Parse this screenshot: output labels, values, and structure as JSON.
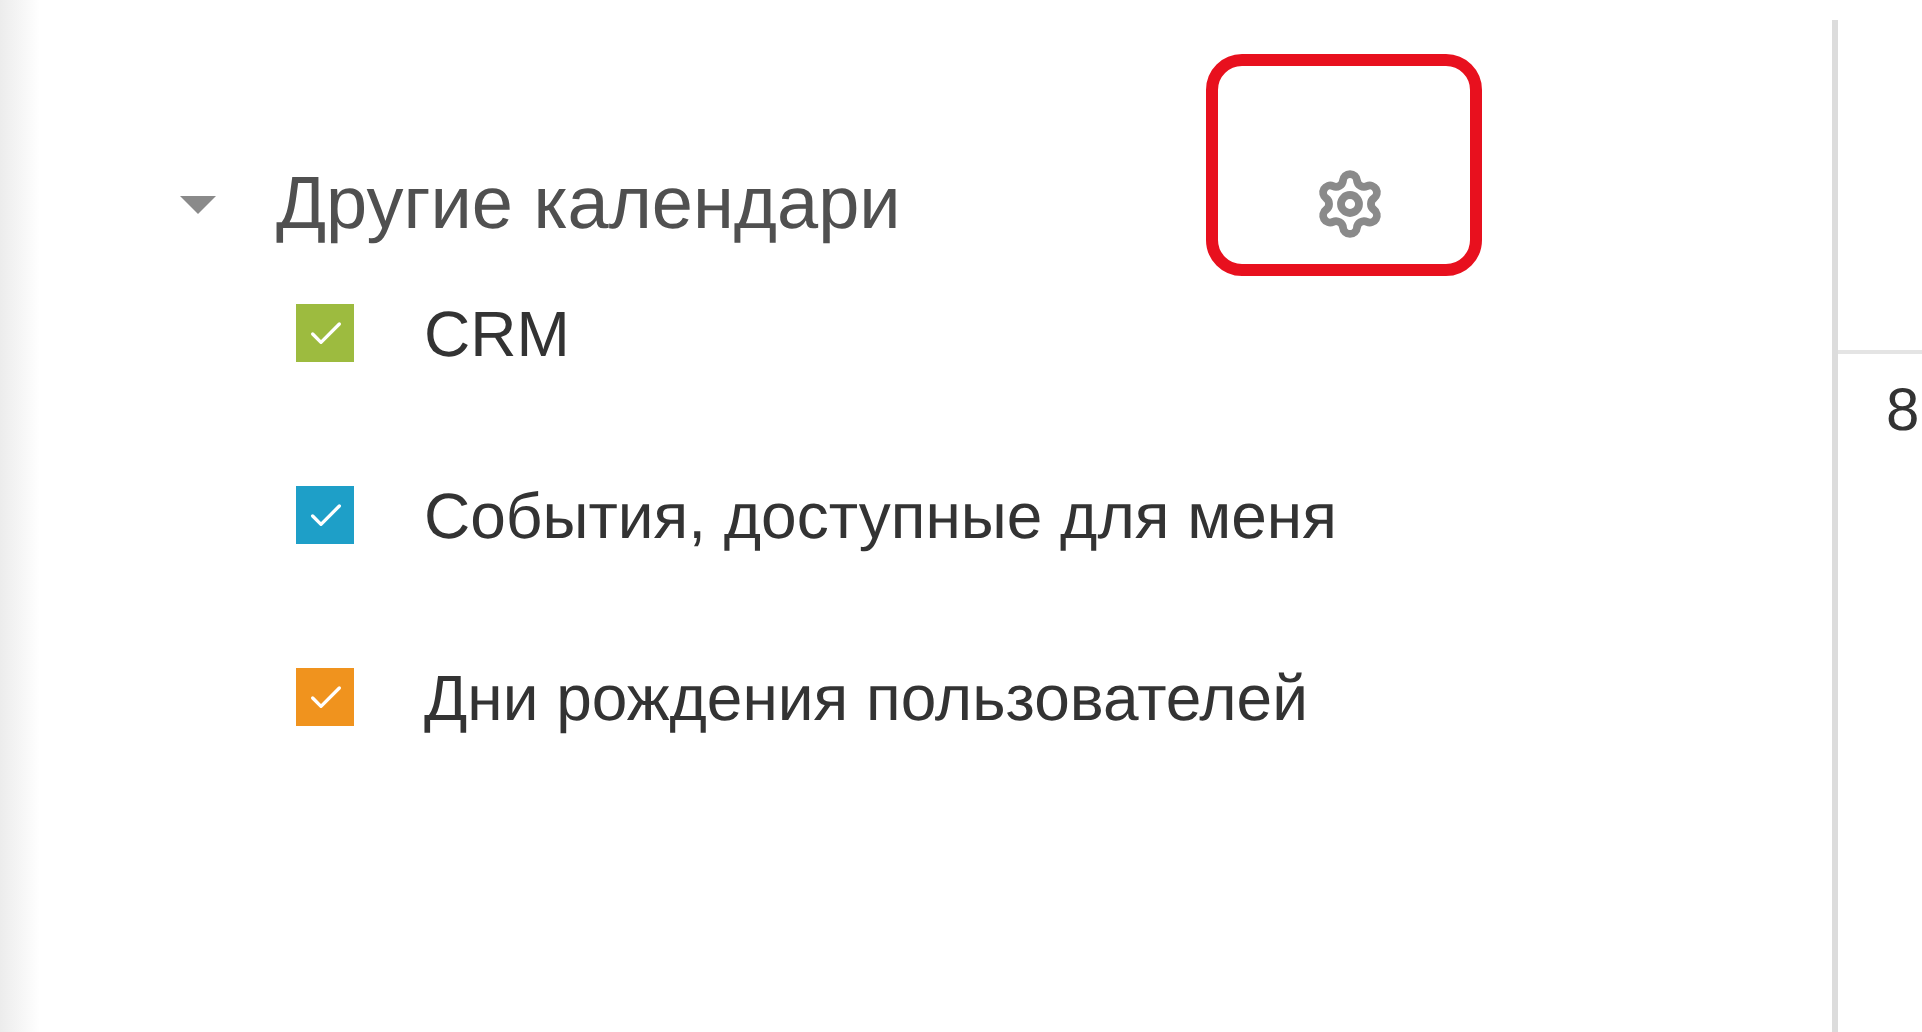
{
  "sidebar": {
    "section": {
      "title": "Другие календари",
      "expanded": true,
      "calendars": [
        {
          "label": "CRM",
          "checked": true,
          "color": "#9dbb3f"
        },
        {
          "label": "События, доступные для меня",
          "checked": true,
          "color": "#1e9fc8"
        },
        {
          "label": "Дни рождения пользователей",
          "checked": true,
          "color": "#f0931e"
        }
      ]
    }
  },
  "calendar_grid": {
    "day": "8"
  }
}
